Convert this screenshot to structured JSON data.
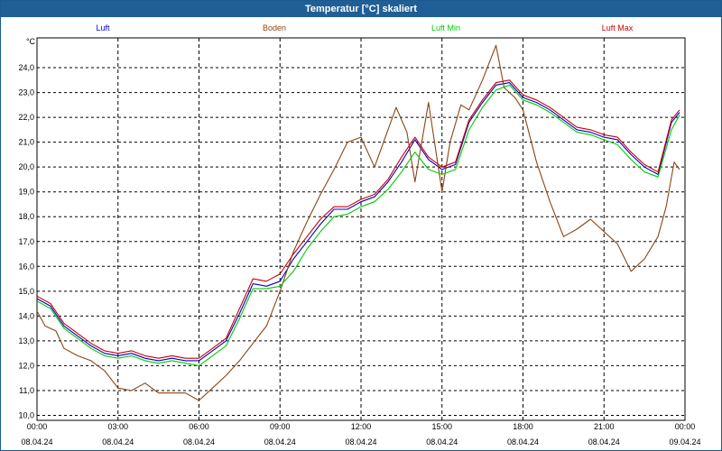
{
  "window": {
    "title": "Temperatur [°C] skaliert"
  },
  "chart_data": {
    "type": "line",
    "title": "Temperatur [°C] skaliert",
    "ylabel": "°C",
    "xlabel": "",
    "ylim": [
      9.8,
      25.2
    ],
    "xlim": [
      0,
      24
    ],
    "grid": true,
    "legend_position": "top",
    "y_ticks": [
      "10,0",
      "11,0",
      "12,0",
      "13,0",
      "14,0",
      "15,0",
      "16,0",
      "17,0",
      "18,0",
      "19,0",
      "20,0",
      "21,0",
      "22,0",
      "23,0",
      "24,0"
    ],
    "x_ticks": [
      {
        "time": "00:00",
        "date": "08.04.24"
      },
      {
        "time": "03:00",
        "date": "08.04.24"
      },
      {
        "time": "06:00",
        "date": "08.04.24"
      },
      {
        "time": "09:00",
        "date": "08.04.24"
      },
      {
        "time": "12:00",
        "date": "08.04.24"
      },
      {
        "time": "15:00",
        "date": "08.04.24"
      },
      {
        "time": "18:00",
        "date": "08.04.24"
      },
      {
        "time": "21:00",
        "date": "08.04.24"
      },
      {
        "time": "00:00",
        "date": "09.04.24"
      }
    ],
    "series": [
      {
        "name": "Luft",
        "color": "#0000cc",
        "x": [
          0,
          0.5,
          1,
          1.5,
          2,
          2.5,
          3,
          3.5,
          4,
          4.5,
          5,
          5.5,
          6,
          6.5,
          7,
          7.5,
          8,
          8.5,
          9,
          9.5,
          10,
          10.5,
          11,
          11.5,
          12,
          12.5,
          13,
          13.5,
          14,
          14.5,
          15,
          15.5,
          16,
          16.5,
          17,
          17.5,
          18,
          18.5,
          19,
          19.5,
          20,
          20.5,
          21,
          21.5,
          22,
          22.5,
          23,
          23.5,
          23.8
        ],
        "y": [
          14.7,
          14.4,
          13.6,
          13.2,
          12.8,
          12.5,
          12.4,
          12.5,
          12.3,
          12.2,
          12.3,
          12.2,
          12.2,
          12.6,
          13.0,
          14.1,
          15.3,
          15.2,
          15.4,
          16.3,
          17.0,
          17.7,
          18.3,
          18.3,
          18.6,
          18.8,
          19.4,
          20.2,
          21.1,
          20.3,
          19.9,
          20.1,
          21.8,
          22.6,
          23.3,
          23.4,
          22.8,
          22.6,
          22.3,
          21.9,
          21.5,
          21.4,
          21.2,
          21.1,
          20.5,
          20.0,
          19.7,
          21.8,
          22.2
        ]
      },
      {
        "name": "Boden",
        "color": "#8b4513",
        "x": [
          0,
          0.3,
          0.7,
          1,
          1.5,
          2,
          2.5,
          3,
          3.5,
          4,
          4.5,
          5,
          5.5,
          6,
          6.5,
          7,
          7.5,
          8,
          8.5,
          9,
          9.5,
          10,
          10.5,
          11,
          11.5,
          12,
          12.5,
          13,
          13.3,
          13.7,
          14,
          14.5,
          15,
          15.3,
          15.7,
          16,
          16.5,
          17,
          17.3,
          17.7,
          18,
          18.5,
          19,
          19.5,
          20,
          20.5,
          21,
          21.5,
          22,
          22.5,
          23,
          23.3,
          23.6,
          23.8
        ],
        "y": [
          14.2,
          13.6,
          13.4,
          12.7,
          12.4,
          12.2,
          11.8,
          11.1,
          11.0,
          11.3,
          10.9,
          10.9,
          10.9,
          10.6,
          11.1,
          11.6,
          12.2,
          12.9,
          13.6,
          15.0,
          16.6,
          17.8,
          18.9,
          19.9,
          21.0,
          21.2,
          20.0,
          21.5,
          22.4,
          21.4,
          19.4,
          22.6,
          19.0,
          21.0,
          22.5,
          22.3,
          23.5,
          24.9,
          23.2,
          22.8,
          22.3,
          20.2,
          18.6,
          17.2,
          17.5,
          17.9,
          17.4,
          16.9,
          15.8,
          16.3,
          17.2,
          18.4,
          20.2,
          19.9
        ]
      },
      {
        "name": "Luft Min",
        "color": "#00cc00",
        "x": [
          0,
          0.5,
          1,
          1.5,
          2,
          2.5,
          3,
          3.5,
          4,
          4.5,
          5,
          5.5,
          6,
          6.5,
          7,
          7.5,
          8,
          8.5,
          9,
          9.5,
          10,
          10.5,
          11,
          11.5,
          12,
          12.5,
          13,
          13.5,
          14,
          14.5,
          15,
          15.5,
          16,
          16.5,
          17,
          17.5,
          18,
          18.5,
          19,
          19.5,
          20,
          20.5,
          21,
          21.5,
          22,
          22.5,
          23,
          23.5,
          23.8
        ],
        "y": [
          14.6,
          14.3,
          13.5,
          13.1,
          12.7,
          12.4,
          12.3,
          12.4,
          12.2,
          12.1,
          12.2,
          12.1,
          12.0,
          12.4,
          12.8,
          13.9,
          15.1,
          15.1,
          15.2,
          15.8,
          16.7,
          17.4,
          18.0,
          18.1,
          18.4,
          18.6,
          19.1,
          19.8,
          20.6,
          19.9,
          19.7,
          19.9,
          21.5,
          22.4,
          23.1,
          23.3,
          22.7,
          22.5,
          22.2,
          21.8,
          21.4,
          21.3,
          21.1,
          20.9,
          20.3,
          19.8,
          19.6,
          21.5,
          22.1
        ]
      },
      {
        "name": "Luft Max",
        "color": "#cc0000",
        "x": [
          0,
          0.5,
          1,
          1.5,
          2,
          2.5,
          3,
          3.5,
          4,
          4.5,
          5,
          5.5,
          6,
          6.5,
          7,
          7.5,
          8,
          8.5,
          9,
          9.5,
          10,
          10.5,
          11,
          11.5,
          12,
          12.5,
          13,
          13.5,
          14,
          14.5,
          15,
          15.5,
          16,
          16.5,
          17,
          17.5,
          18,
          18.5,
          19,
          19.5,
          20,
          20.5,
          21,
          21.5,
          22,
          22.5,
          23,
          23.5,
          23.8
        ],
        "y": [
          14.8,
          14.5,
          13.7,
          13.3,
          12.9,
          12.6,
          12.5,
          12.6,
          12.4,
          12.3,
          12.4,
          12.3,
          12.3,
          12.7,
          13.1,
          14.3,
          15.5,
          15.4,
          15.7,
          16.5,
          17.2,
          17.9,
          18.4,
          18.4,
          18.7,
          18.9,
          19.5,
          20.4,
          21.2,
          20.4,
          20.0,
          20.2,
          21.9,
          22.7,
          23.4,
          23.5,
          22.9,
          22.7,
          22.4,
          22.0,
          21.6,
          21.5,
          21.3,
          21.2,
          20.6,
          20.1,
          19.8,
          21.9,
          22.3
        ]
      }
    ]
  }
}
